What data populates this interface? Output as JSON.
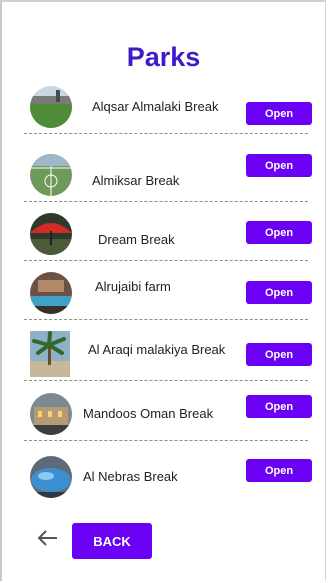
{
  "page": {
    "title": "Parks"
  },
  "parks": [
    {
      "name": "Alqsar Almalaki Break",
      "open_label": "Open",
      "icon": "park-photo-grass-field"
    },
    {
      "name": "Almiksar Break",
      "open_label": "Open",
      "icon": "park-photo-football-field"
    },
    {
      "name": "Dream Break",
      "open_label": "Open",
      "icon": "park-photo-red-umbrella"
    },
    {
      "name": "Alrujaibi farm",
      "open_label": "Open",
      "icon": "park-photo-pool"
    },
    {
      "name": "Al Araqi malakiya Break",
      "open_label": "Open",
      "icon": "park-photo-palm-courtyard"
    },
    {
      "name": "Mandoos Oman Break",
      "open_label": "Open",
      "icon": "park-photo-building-night"
    },
    {
      "name": "Al Nebras Break",
      "open_label": "Open",
      "icon": "park-photo-pool-blue"
    }
  ],
  "footer": {
    "back_icon": "arrow-left-icon",
    "back_label": "BACK"
  },
  "colors": {
    "title": "#3f1bc9",
    "button": "#6a00f4",
    "button_text": "#ffffff",
    "separator": "#8f8f8f"
  }
}
